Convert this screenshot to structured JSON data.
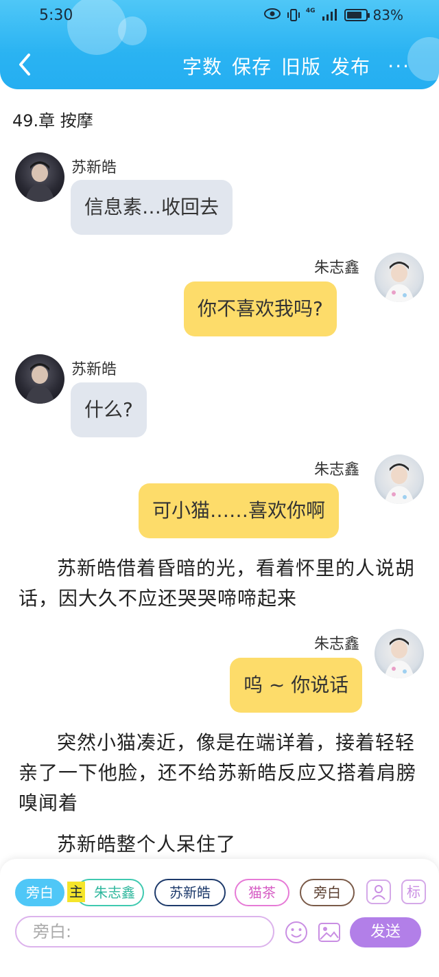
{
  "status_bar": {
    "time": "5:30",
    "network": "4G",
    "battery": "83%",
    "battery_level": 0.83
  },
  "header": {
    "actions": [
      "字数",
      "保存",
      "旧版",
      "发布"
    ],
    "more": "···"
  },
  "chapter_title": "49.章 按摩",
  "messages": [
    {
      "speaker": "苏新皓",
      "side": "left",
      "text": "信息素…收回去"
    },
    {
      "speaker": "朱志鑫",
      "side": "right",
      "text": "你不喜欢我吗?"
    },
    {
      "speaker": "苏新皓",
      "side": "left",
      "text": "什么?"
    },
    {
      "speaker": "朱志鑫",
      "side": "right",
      "text": "可小猫……喜欢你啊"
    },
    {
      "speaker": "朱志鑫",
      "side": "right",
      "text": "呜 ~ 你说话"
    }
  ],
  "narrations": [
    "苏新皓借着昏暗的光，看着怀里的人说胡话，因大久不应还哭哭啼啼起来",
    "突然小猫凑近，像是在端详着，接着轻轻亲了一下他脸，还不给苏新皓反应又搭着肩膀嗅闻着",
    "苏新皓整个人呆住了"
  ],
  "bottom_panel": {
    "roles": [
      "旁白",
      "朱志鑫",
      "苏新皓",
      "猫茶",
      "旁白"
    ],
    "main_mark": "主",
    "tag_icon": "标",
    "input_placeholder": "旁白:",
    "send_label": "发送"
  },
  "colors": {
    "header": "#2ab3f2",
    "bubble_left": "#e1e6ee",
    "bubble_right": "#fddc6a",
    "send_button": "#b27fe8"
  },
  "icons": {
    "back": "chevron-left-icon",
    "eye": "eye-icon",
    "vibrate": "vibrate-icon",
    "signal": "signal-icon",
    "battery": "battery-icon",
    "person": "person-card-icon",
    "emoji": "emoji-icon",
    "image": "image-icon"
  }
}
